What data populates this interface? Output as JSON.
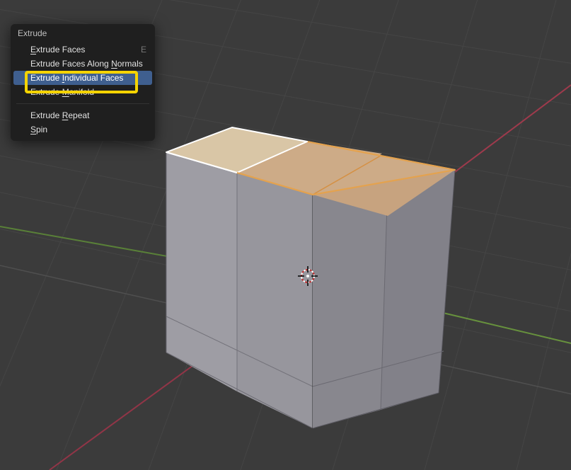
{
  "menu": {
    "title": "Extrude",
    "items": [
      {
        "label": "Extrude Faces",
        "underline_char_index": 0,
        "shortcut": "E",
        "highlighted": false
      },
      {
        "label": "Extrude Faces Along Normals",
        "underline_char_index": 20,
        "shortcut": "",
        "highlighted": false
      },
      {
        "label": "Extrude Individual Faces",
        "underline_char_index": 8,
        "shortcut": "",
        "highlighted": true,
        "framed": true
      },
      {
        "label": "Extrude Manifold",
        "underline_char_index": 8,
        "shortcut": "",
        "highlighted": false
      }
    ],
    "items2": [
      {
        "label": "Extrude Repeat",
        "underline_char_index": 8,
        "shortcut": "",
        "highlighted": false
      },
      {
        "label": "Spin",
        "underline_char_index": 0,
        "shortcut": "",
        "highlighted": false
      }
    ]
  },
  "viewport": {
    "background_color": "#3b3b3b",
    "grid_major_color": "#4c4c4c",
    "grid_minor_color": "#454545",
    "axis_x_color": "#a03044",
    "axis_y_color": "#6a9a3a",
    "cube": {
      "active_face_color": "#d8c29e",
      "selected_face_color": "#cba887",
      "selected_edge_color": "#e4a24e",
      "active_edge_color": "#ffffff",
      "side_light": "#9f9ea4",
      "side_dark": "#8b8a90",
      "top_faces_selected": 3
    }
  }
}
